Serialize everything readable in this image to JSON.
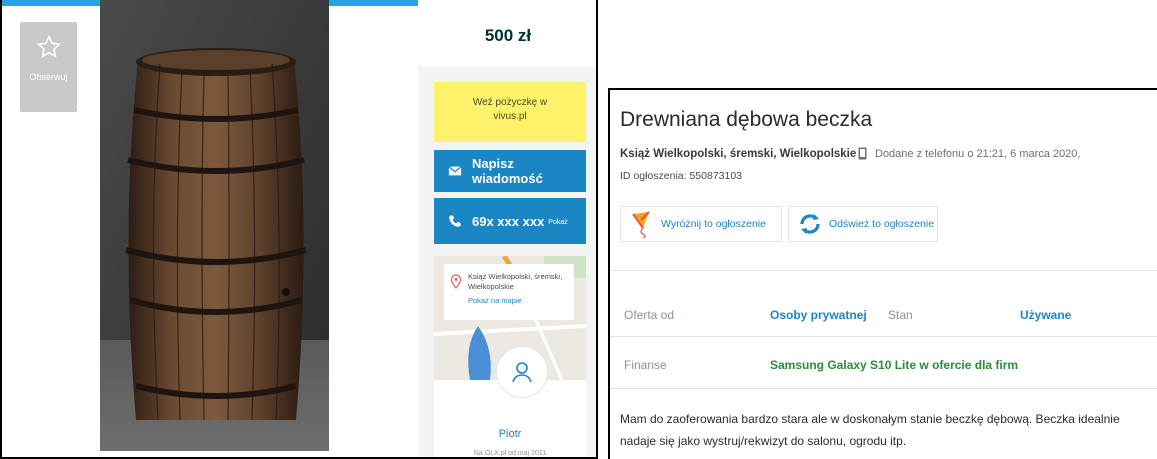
{
  "gallery": {
    "observe_label": "Obserwuj"
  },
  "sidebar": {
    "price": "500 zł",
    "loan_line1": "Weź pożyczkę w",
    "loan_line2": "vivus.pl",
    "message_label": "Napisz wiadomość",
    "phone_number": "69x xxx xxx",
    "phone_show_label": "Pokaż",
    "map": {
      "location_line1": "Książ Wielkopolski, śremski,",
      "location_line2": "Wielkopolskie",
      "show_on_map": "Pokaż na mapie"
    },
    "user": {
      "name": "Piotr",
      "since": "Na OLX.pl od maj 2011"
    }
  },
  "listing": {
    "title": "Drewniana dębowa beczka",
    "location": "Książ Wielkopolski, śremski, Wielkopolskie",
    "added": "Dodane z telefonu   o 21:21, 6 marca 2020,",
    "id_label": "ID ogłoszenia: 550873103",
    "promote_label": "Wyróżnij to ogłoszenie",
    "refresh_label": "Odśwież to ogłoszenie",
    "params": {
      "offer_from_label": "Oferta od",
      "offer_from_value": "Osoby prywatnej",
      "state_label": "Stan",
      "state_value": "Używane",
      "finance_label": "Finanse",
      "finance_value": "Samsung Galaxy S10 Lite w ofercie dla firm"
    },
    "description": "Mam do zaoferowania bardzo stara ale w doskonałym stanie beczkę dębową. Beczka idealnie nadaje się jako wystruj/rekwizyt do salonu, ogrodu itp."
  },
  "colors": {
    "accent_blue": "#1b86c4",
    "top_bar": "#23a6dc",
    "loan_yellow": "#fdf26a",
    "finance_green": "#2e8b3a"
  },
  "icons": [
    "star-icon",
    "envelope-icon",
    "phone-icon",
    "map-pin-icon",
    "user-icon",
    "kite-icon",
    "refresh-icon",
    "mobile-icon"
  ]
}
